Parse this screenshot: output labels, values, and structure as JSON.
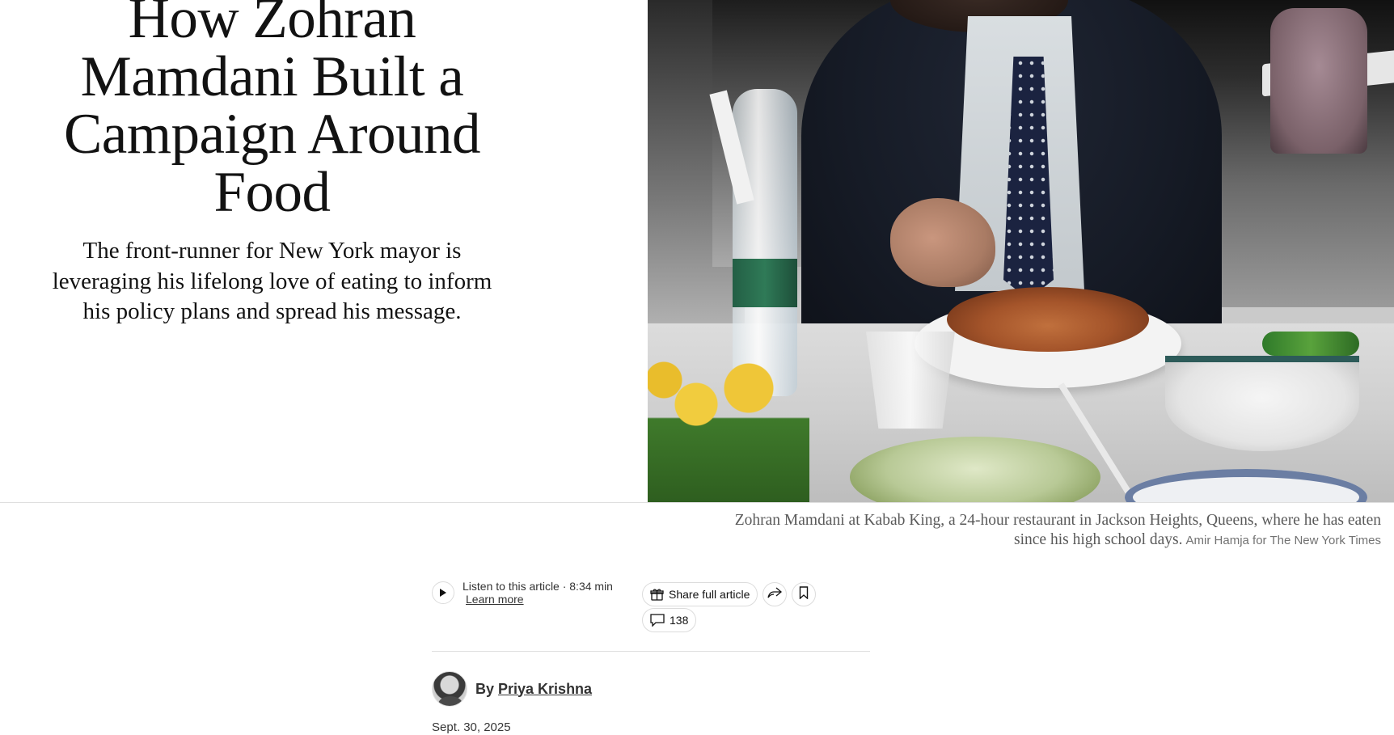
{
  "article": {
    "headline": "How Zohran Mamdani Built a Campaign Around Food",
    "summary": "The front-runner for New York mayor is leveraging his lifelong love of eating to inform his policy plans and spread his message."
  },
  "image": {
    "caption": "Zohran Mamdani at Kabab King, a 24-hour restaurant in Jackson Heights, Queens, where he has eaten since his high school days.",
    "credit": "Amir Hamja for The New York Times"
  },
  "tools": {
    "listen_label": "Listen to this article · 8:34 min",
    "learn_more": "Learn more",
    "share_label": "Share full article",
    "comment_count": "138",
    "icons": [
      "play-icon",
      "gift-icon",
      "forward-icon",
      "bookmark-icon",
      "comment-icon"
    ]
  },
  "byline": {
    "prefix": "By",
    "author": "Priya Krishna",
    "date": "Sept. 30, 2025"
  }
}
